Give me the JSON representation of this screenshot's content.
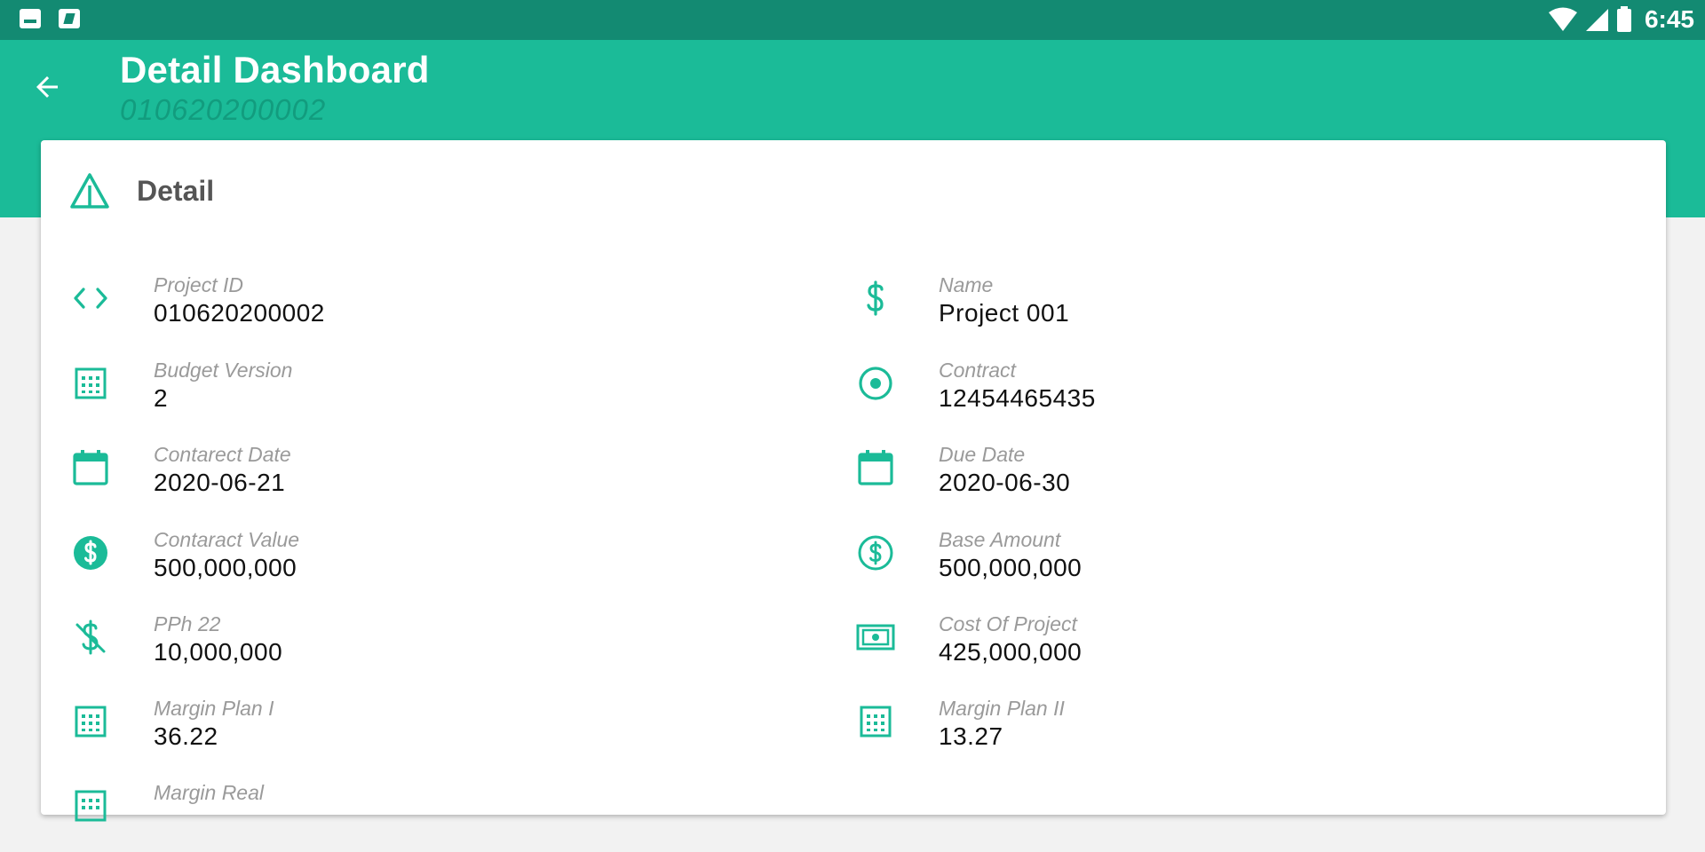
{
  "status_bar": {
    "time": "6:45",
    "left_icons": [
      "notification-image-icon",
      "notification-photo-icon"
    ],
    "right_icons": [
      "wifi-icon",
      "cellular-signal-icon",
      "battery-icon"
    ]
  },
  "app_bar": {
    "title": "Detail Dashboard",
    "subtitle": "010620200002",
    "back_icon": "arrow-back-icon"
  },
  "card": {
    "title": "Detail",
    "title_icon": "warning-triangle-icon",
    "fields": [
      {
        "label": "Project ID",
        "value": "010620200002",
        "icon": "code-icon"
      },
      {
        "label": "Name",
        "value": "Project 001",
        "icon": "dollar-icon"
      },
      {
        "label": "Budget Version",
        "value": "2",
        "icon": "calculator-icon"
      },
      {
        "label": "Contract",
        "value": "12454465435",
        "icon": "radio-button-icon"
      },
      {
        "label": "Contarect Date",
        "value": "2020-06-21",
        "icon": "calendar-icon"
      },
      {
        "label": "Due Date",
        "value": "2020-06-30",
        "icon": "calendar-icon"
      },
      {
        "label": "Contaract Value",
        "value": "500,000,000",
        "icon": "dollar-circle-filled-icon"
      },
      {
        "label": "Base Amount",
        "value": "500,000,000",
        "icon": "dollar-circle-outline-icon"
      },
      {
        "label": "PPh 22",
        "value": "10,000,000",
        "icon": "dollar-off-icon"
      },
      {
        "label": "Cost Of Project",
        "value": "425,000,000",
        "icon": "money-bill-icon"
      },
      {
        "label": "Margin Plan I",
        "value": "36.22",
        "icon": "calculator-icon"
      },
      {
        "label": "Margin Plan II",
        "value": "13.27",
        "icon": "calculator-icon"
      },
      {
        "label": "Margin Real",
        "value": "",
        "icon": "calculator-icon"
      }
    ]
  },
  "colors": {
    "status_bar": "#138a72",
    "app_bar": "#1bbb98",
    "subtitle": "#129c7e",
    "accent": "#1bbb98",
    "label": "#9a9a9a",
    "value": "#111111"
  }
}
